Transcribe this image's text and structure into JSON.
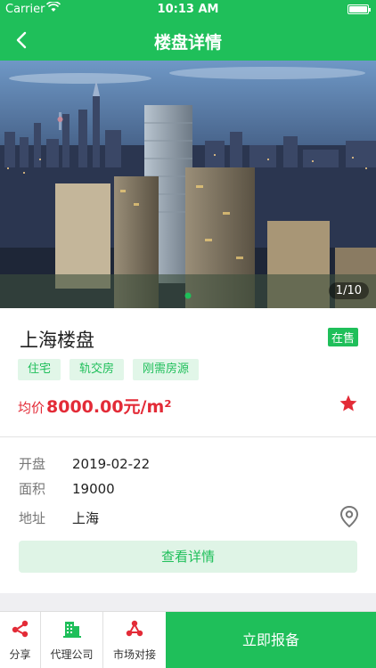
{
  "status_bar": {
    "carrier": "Carrier",
    "time": "10:13 AM"
  },
  "nav": {
    "title": "楼盘详情",
    "back_icon": "chevron-left-icon"
  },
  "gallery": {
    "counter": "1/10"
  },
  "property": {
    "name": "上海楼盘",
    "status": "在售",
    "tags": [
      "住宅",
      "轨交房",
      "刚需房源"
    ],
    "price_label": "均价",
    "price_value": "8000.00元/m²",
    "favorite": true
  },
  "details": {
    "rows": [
      {
        "key": "开盘",
        "value": "2019-02-22"
      },
      {
        "key": "面积",
        "value": "19000"
      },
      {
        "key": "地址",
        "value": "上海"
      }
    ],
    "more_button": "查看详情"
  },
  "tabbar": {
    "items": [
      {
        "label": "分享",
        "icon": "share-icon"
      },
      {
        "label": "代理公司",
        "icon": "building-icon"
      },
      {
        "label": "市场对接",
        "icon": "connect-icon"
      }
    ],
    "primary": "立即报备"
  },
  "colors": {
    "brand": "#1fbf5a",
    "price": "#e32b37",
    "tag_bg": "#e1f6e8"
  }
}
